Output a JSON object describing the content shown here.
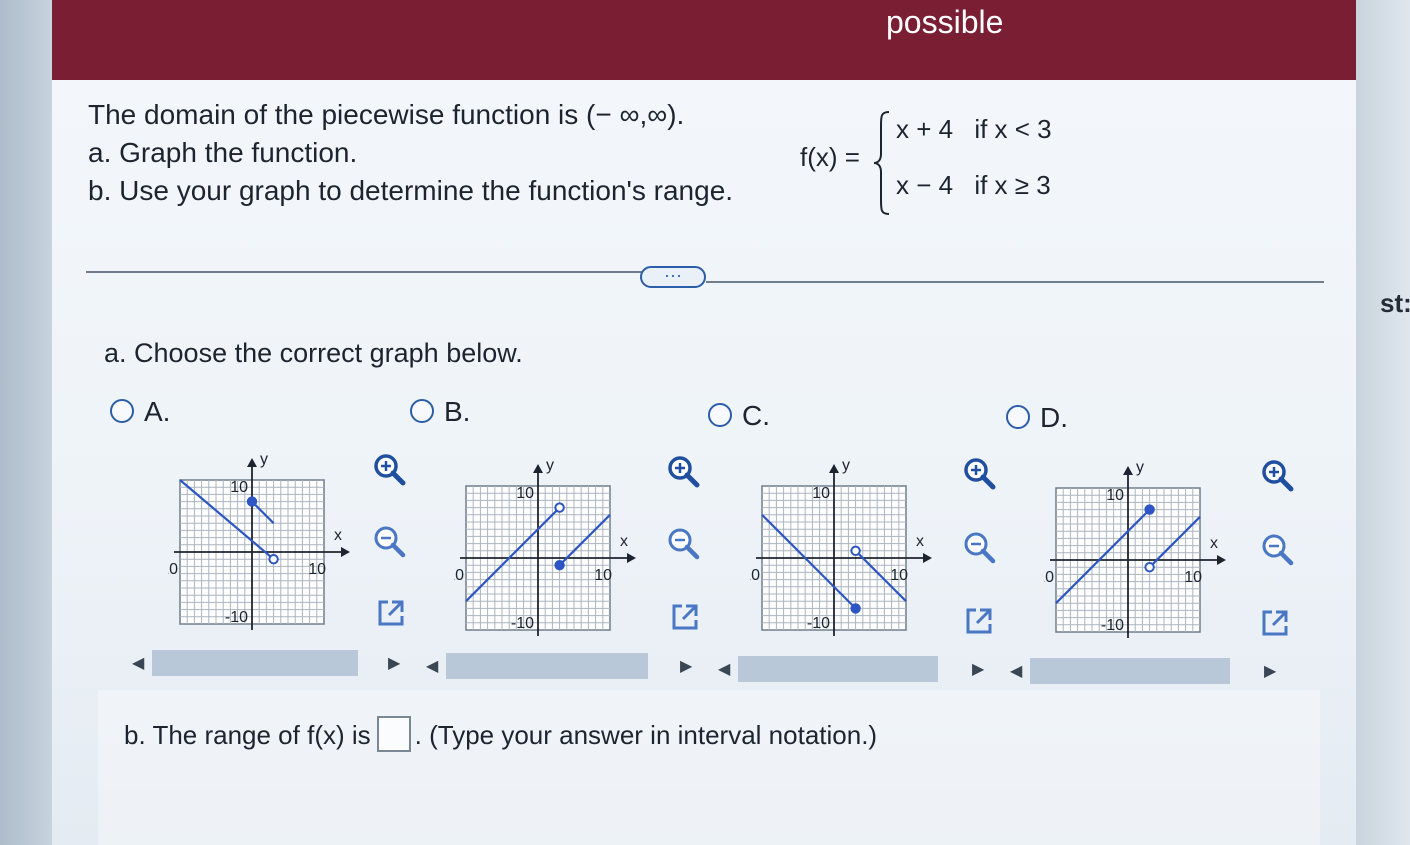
{
  "header": {
    "title": "possible"
  },
  "side_text": "st:",
  "problem": {
    "line1": "The domain of the piecewise function is (− ∞,∞).",
    "line2": "a. Graph the function.",
    "line3": "b. Use your graph to determine the function's range."
  },
  "function": {
    "name": "f(x) =",
    "cases": [
      {
        "expr": "x + 4",
        "condition": "if  x < 3"
      },
      {
        "expr": "x − 4",
        "condition": "if  x ≥ 3"
      }
    ]
  },
  "expand_button": "···",
  "part_a": {
    "prompt": "a. Choose the correct graph below.",
    "options": [
      {
        "letter": "A.",
        "left_segment": {
          "from": [
            -10,
            10
          ],
          "to": [
            3,
            -1
          ],
          "end": "open"
        },
        "right_segment": {
          "from": [
            0,
            7
          ],
          "to": [
            3,
            4
          ],
          "start": "closed"
        }
      },
      {
        "letter": "B.",
        "left_segment": {
          "from": [
            -10,
            -6
          ],
          "to": [
            3,
            7
          ],
          "end": "open"
        },
        "right_segment": {
          "from": [
            3,
            -1
          ],
          "to": [
            10,
            6
          ],
          "start": "closed"
        }
      },
      {
        "letter": "C.",
        "left_segment": {
          "from": [
            -10,
            6
          ],
          "to": [
            3,
            -7
          ],
          "end": "closed"
        },
        "right_segment": {
          "from": [
            3,
            1
          ],
          "to": [
            10,
            -6
          ],
          "start": "open"
        }
      },
      {
        "letter": "D.",
        "left_segment": {
          "from": [
            -10,
            -6
          ],
          "to": [
            3,
            7
          ],
          "end": "closed"
        },
        "right_segment": {
          "from": [
            3,
            -1
          ],
          "to": [
            10,
            6
          ],
          "start": "open"
        }
      }
    ],
    "axis": {
      "min": -10,
      "max": 10,
      "pos_label": "10",
      "neg_label": "-10",
      "x_label": "x",
      "y_label": "y"
    },
    "tools": {
      "zoom_in": "zoom-in-icon",
      "zoom_out": "zoom-out-icon",
      "open": "external-link-icon"
    }
  },
  "part_b": {
    "prefix": "b. The range of f(x) is",
    "suffix": ". (Type your answer in interval notation.)"
  },
  "colors": {
    "header": "#7a1e34",
    "accent": "#2c5da8",
    "line": "#2d55c4",
    "grid": "#6f7d8c"
  }
}
